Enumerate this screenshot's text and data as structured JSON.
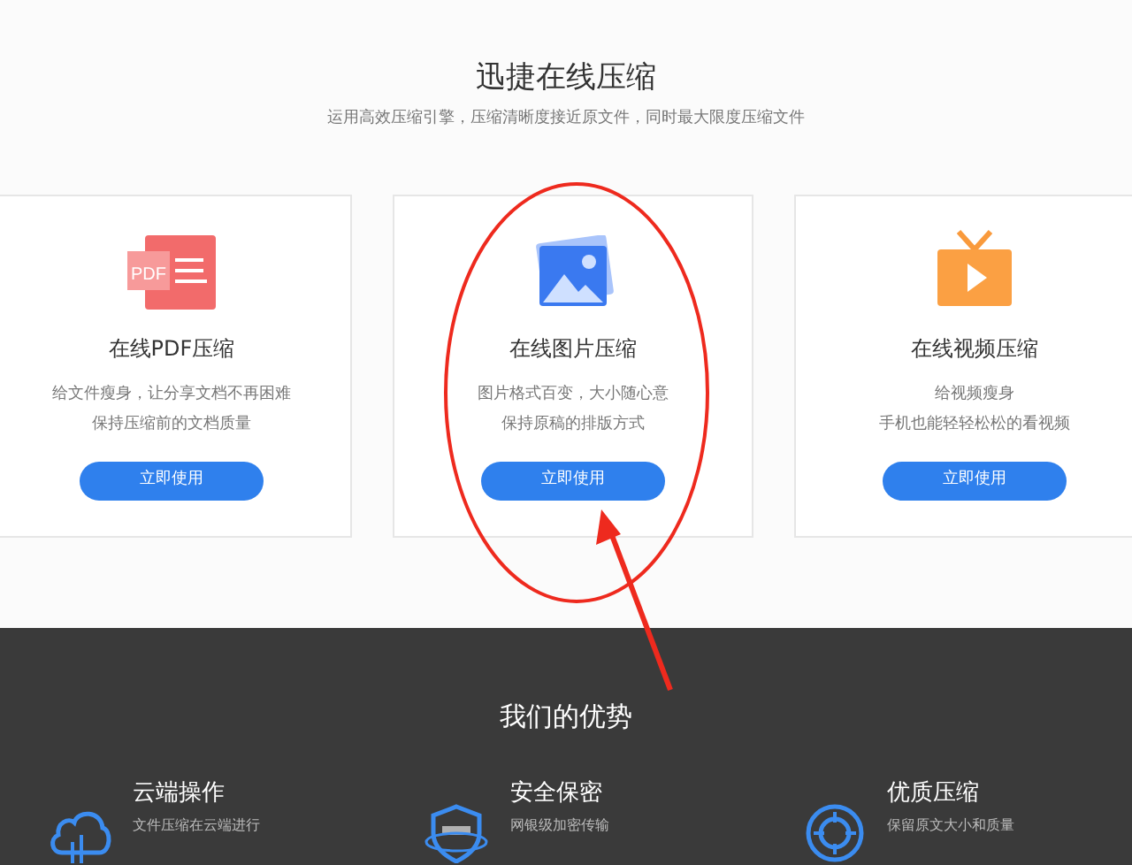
{
  "hero": {
    "title": "迅捷在线压缩",
    "subtitle": "运用高效压缩引擎，压缩清晰度接近原文件，同时最大限度压缩文件"
  },
  "cards": [
    {
      "kind": "pdf",
      "title": "在线PDF压缩",
      "lines": [
        "给文件瘦身，让分享文档不再困难",
        "保持压缩前的文档质量"
      ],
      "button": "立即使用",
      "icon_text": "PDF"
    },
    {
      "kind": "image",
      "title": "在线图片压缩",
      "lines": [
        "图片格式百变，大小随心意",
        "保持原稿的排版方式"
      ],
      "button": "立即使用"
    },
    {
      "kind": "video",
      "title": "在线视频压缩",
      "lines": [
        "给视频瘦身",
        "手机也能轻轻松松的看视频"
      ],
      "button": "立即使用"
    }
  ],
  "advantages": {
    "title": "我们的优势",
    "items": [
      {
        "kind": "cloud",
        "title": "云端操作",
        "text": "文件压缩在云端进行"
      },
      {
        "kind": "shield",
        "title": "安全保密",
        "text": "网银级加密传输"
      },
      {
        "kind": "target",
        "title": "优质压缩",
        "text": "保留原文大小和质量"
      }
    ]
  }
}
